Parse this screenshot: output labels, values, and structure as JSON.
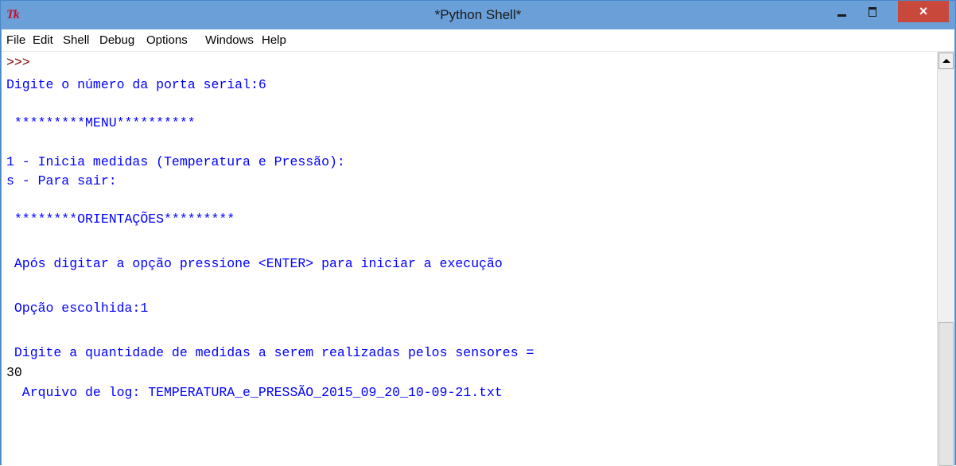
{
  "window": {
    "icon": "Tk",
    "title": "*Python Shell*",
    "close_glyph": "×"
  },
  "menu": [
    "File",
    "Edit",
    "Shell",
    "Debug",
    "Options",
    "Windows",
    "Help"
  ],
  "shell": {
    "lines": [
      ">>> ",
      "Digite o número da porta serial:",
      "6",
      " *********MENU**********",
      "1 - Inicia medidas (Temperatura e Pressão):",
      "s - Para sair:",
      " ********ORIENTAÇÕES*********",
      " Após digitar a opção pressione <ENTER> para iniciar a execução",
      " Opção escolhida:",
      "1",
      " Digite a quantidade de medidas a serem realizadas pelos sensores = ",
      "30",
      "  Arquivo de log: TEMPERATURA_e_PRESSÃO_2015_09_20_10-09-21.txt"
    ]
  },
  "colors": {
    "output": "#0000ff",
    "prompt": "#7a0000",
    "input": "#000000",
    "titlebar": "#6b9fd8",
    "close": "#c9483c"
  }
}
